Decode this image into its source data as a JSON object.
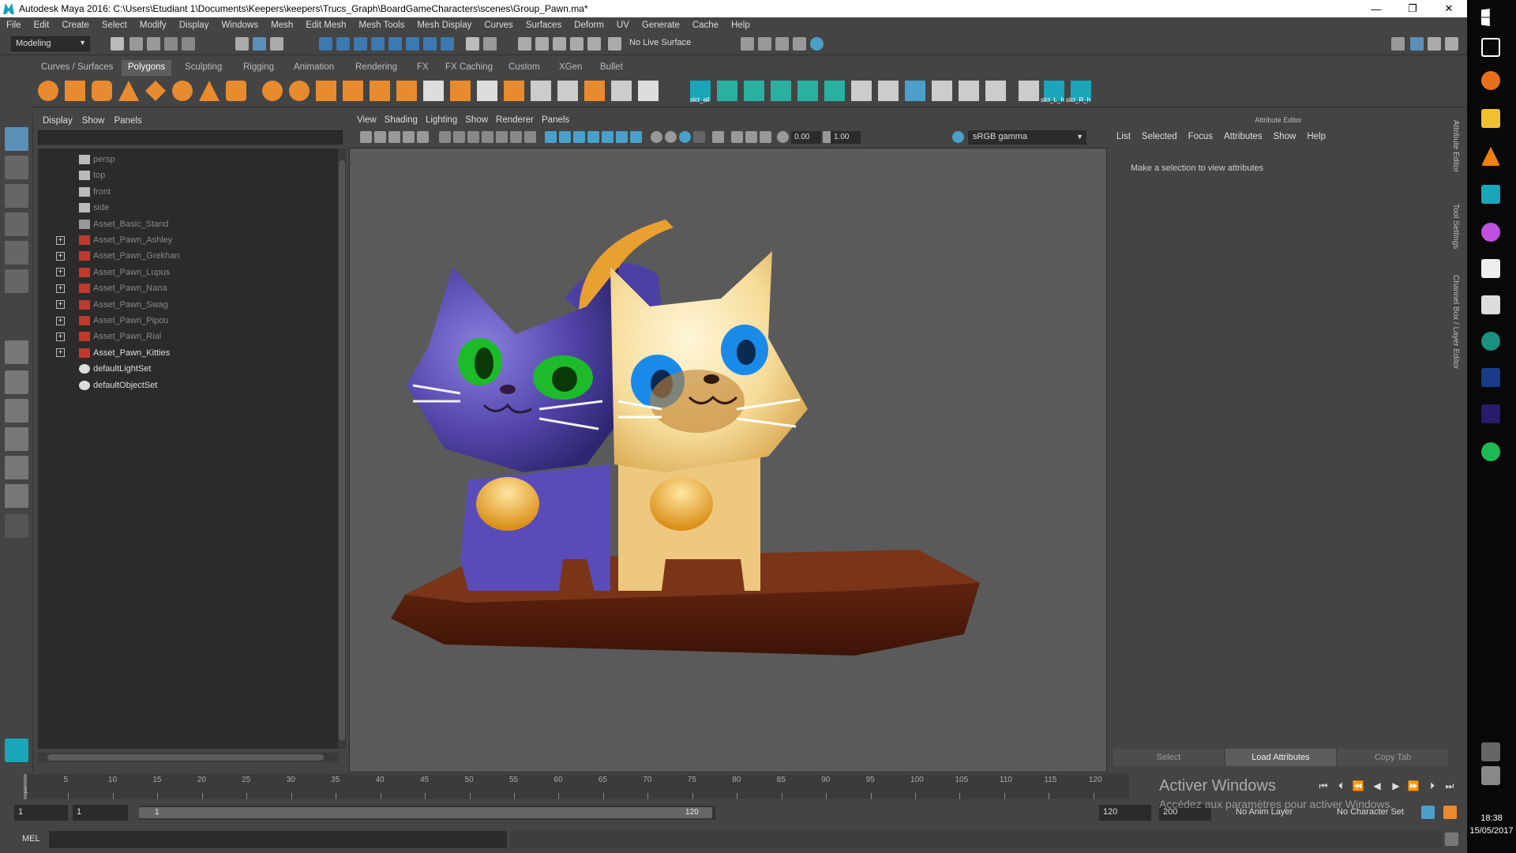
{
  "window": {
    "title": "Autodesk Maya 2016: C:\\Users\\Etudiant 1\\Documents\\Keepers\\keepers\\Trucs_Graph\\BoardGameCharacters\\scenes\\Group_Pawn.ma*"
  },
  "menubar": [
    "File",
    "Edit",
    "Create",
    "Select",
    "Modify",
    "Display",
    "Windows",
    "Mesh",
    "Edit Mesh",
    "Mesh Tools",
    "Mesh Display",
    "Curves",
    "Surfaces",
    "Deform",
    "UV",
    "Generate",
    "Cache",
    "Help"
  ],
  "status": {
    "mode": "Modeling",
    "live_surface": "No Live Surface"
  },
  "shelf": {
    "tabs": [
      "Curves / Surfaces",
      "Polygons",
      "Sculpting",
      "Rigging",
      "Animation",
      "Rendering",
      "FX",
      "FX Caching",
      "Custom",
      "XGen",
      "Bullet"
    ],
    "active_tab": "Polygons",
    "labels": [
      "slct_all",
      "slct_L_h",
      "slct_R_h"
    ]
  },
  "outliner": {
    "menu": [
      "Display",
      "Show",
      "Panels"
    ],
    "items": [
      {
        "name": "persp",
        "icon": "camera-icon",
        "expandable": false,
        "dim": true
      },
      {
        "name": "top",
        "icon": "camera-icon",
        "expandable": false,
        "dim": true
      },
      {
        "name": "front",
        "icon": "camera-icon",
        "expandable": false,
        "dim": true
      },
      {
        "name": "side",
        "icon": "camera-icon",
        "expandable": false,
        "dim": true
      },
      {
        "name": "Asset_Basic_Stand",
        "icon": "mesh-icon",
        "expandable": false,
        "dim": true
      },
      {
        "name": "Asset_Pawn_Ashley",
        "icon": "group-icon",
        "expandable": true,
        "dim": true
      },
      {
        "name": "Asset_Pawn_Grekhan",
        "icon": "group-icon",
        "expandable": true,
        "dim": true
      },
      {
        "name": "Asset_Pawn_Lupus",
        "icon": "group-icon",
        "expandable": true,
        "dim": true
      },
      {
        "name": "Asset_Pawn_Nana",
        "icon": "group-icon",
        "expandable": true,
        "dim": true
      },
      {
        "name": "Asset_Pawn_Swag",
        "icon": "group-icon",
        "expandable": true,
        "dim": true
      },
      {
        "name": "Asset_Pawn_Pipou",
        "icon": "group-icon",
        "expandable": true,
        "dim": true
      },
      {
        "name": "Asset_Pawn_Rial",
        "icon": "group-icon",
        "expandable": true,
        "dim": true
      },
      {
        "name": "Asset_Pawn_Kitties",
        "icon": "group-icon",
        "expandable": true,
        "dim": false
      },
      {
        "name": "defaultLightSet",
        "icon": "set-icon",
        "expandable": false,
        "dim": false
      },
      {
        "name": "defaultObjectSet",
        "icon": "set-icon",
        "expandable": false,
        "dim": false
      }
    ]
  },
  "viewport": {
    "menu": [
      "View",
      "Shading",
      "Lighting",
      "Show",
      "Renderer",
      "Panels"
    ],
    "exposure": "0.00",
    "gamma_value": "1.00",
    "color_space": "sRGB gamma"
  },
  "attribute_editor": {
    "title": "Attribute Editor",
    "menu": [
      "List",
      "Selected",
      "Focus",
      "Attributes",
      "Show",
      "Help"
    ],
    "message": "Make a selection to view attributes",
    "buttons": [
      "Select",
      "Load Attributes",
      "Copy Tab"
    ],
    "side_tabs": [
      "Attribute Editor",
      "Tool Settings",
      "Channel Box / Layer Editor"
    ]
  },
  "timeline": {
    "ticks": [
      "5",
      "10",
      "15",
      "20",
      "25",
      "30",
      "35",
      "40",
      "45",
      "50",
      "55",
      "60",
      "65",
      "70",
      "75",
      "80",
      "85",
      "90",
      "95",
      "100",
      "105",
      "110",
      "115",
      "120"
    ],
    "current_frame_marker": "1"
  },
  "range": {
    "start": "1",
    "playback_start": "1",
    "slider_start": "1",
    "slider_end": "120",
    "playback_end": "120",
    "end": "200",
    "anim_layer": "No Anim Layer",
    "character_set": "No Character Set"
  },
  "command": {
    "label": "MEL"
  },
  "watermark": {
    "title": "Activer Windows",
    "subtitle": "Accédez aux paramètres pour activer Windows."
  },
  "clock": {
    "time": "18:38",
    "date": "15/05/2017"
  }
}
